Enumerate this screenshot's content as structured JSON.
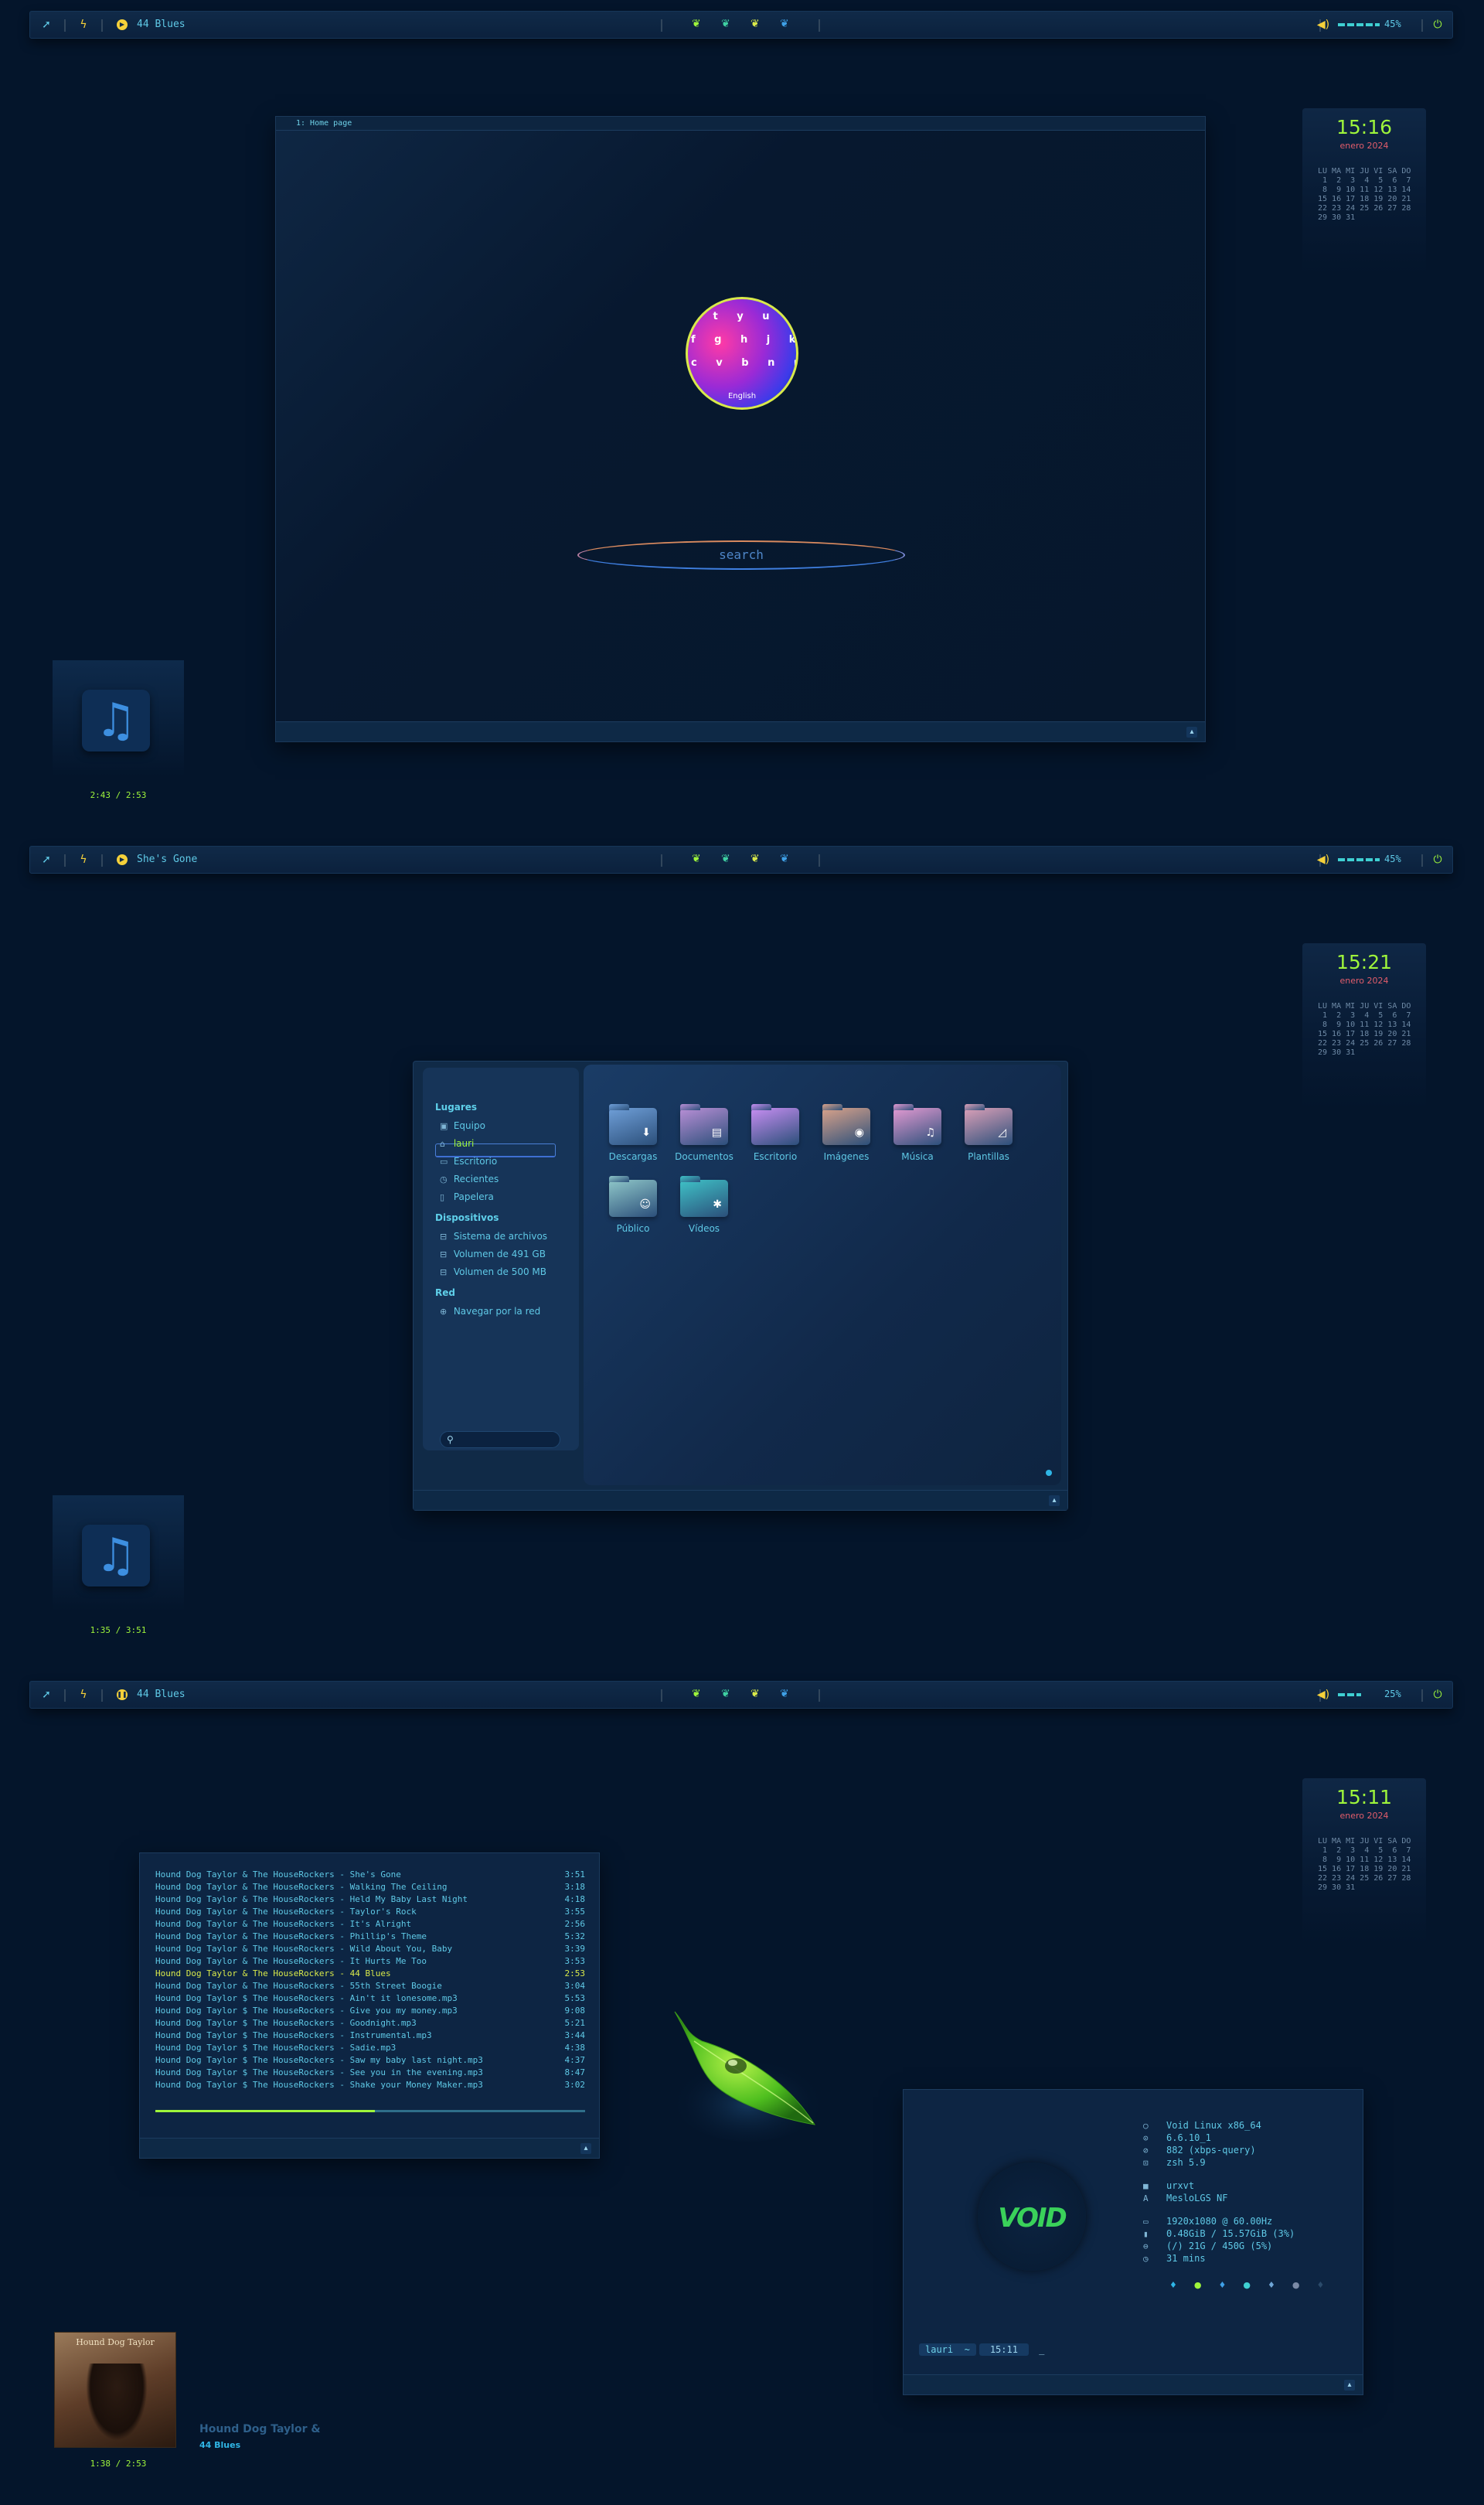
{
  "colors": {
    "bg": "#04152b",
    "accent": "#5fc9e6",
    "lime": "#9ef53b",
    "date_red": "#e25d6b",
    "yellow": "#d8e94a"
  },
  "bars": [
    {
      "track": "44 Blues",
      "volume": "45%",
      "volume_level": 0.45
    },
    {
      "track": "She's Gone",
      "volume": "45%",
      "volume_level": 0.45
    },
    {
      "track": "44 Blues",
      "volume": "25%",
      "volume_level": 0.25
    }
  ],
  "clocks": [
    {
      "time": "15:16",
      "date": "enero 2024"
    },
    {
      "time": "15:21",
      "date": "enero 2024"
    },
    {
      "time": "15:11",
      "date": "enero 2024"
    }
  ],
  "calendar": {
    "header": "LU MA MI JU VI SA DO",
    "weeks": [
      " 1  2  3  4  5  6  7",
      " 8  9 10 11 12 13 14",
      "15 16 17 18 19 20 21",
      "22 23 24 25 26 27 28",
      "29 30 31"
    ]
  },
  "music_times": [
    "2:43 / 2:53",
    "1:35 / 3:51",
    "1:38 / 2:53"
  ],
  "browser": {
    "tab": "1: Home page",
    "keyboard_keys": "t y u\nf g h j k\nc v b n m",
    "keyboard_lang": "English",
    "search_placeholder": "search"
  },
  "file_manager": {
    "sections": [
      {
        "title": "Lugares",
        "items": [
          {
            "icon": "computer-icon",
            "label": "Equipo"
          },
          {
            "icon": "home-icon",
            "label": "lauri"
          },
          {
            "icon": "desktop-icon",
            "label": "Escritorio"
          },
          {
            "icon": "clock-icon",
            "label": "Recientes"
          },
          {
            "icon": "trash-icon",
            "label": "Papelera"
          }
        ]
      },
      {
        "title": "Dispositivos",
        "items": [
          {
            "icon": "drive-icon",
            "label": "Sistema de archivos"
          },
          {
            "icon": "drive-icon",
            "label": "Volumen de 491 GB"
          },
          {
            "icon": "drive-icon",
            "label": "Volumen de 500 MB"
          }
        ]
      },
      {
        "title": "Red",
        "items": [
          {
            "icon": "network-icon",
            "label": "Navegar por la red"
          }
        ]
      }
    ],
    "folders": [
      {
        "label": "Descargas",
        "icon": "download-icon",
        "color": "#6f9fd8"
      },
      {
        "label": "Documentos",
        "icon": "document-icon",
        "color": "#b98fd6"
      },
      {
        "label": "Escritorio",
        "icon": "desktop-icon",
        "color": "#c78ef2"
      },
      {
        "label": "Imágenes",
        "icon": "camera-icon",
        "color": "#d9a28a"
      },
      {
        "label": "Música",
        "icon": "music-icon",
        "color": "#e39ad2"
      },
      {
        "label": "Plantillas",
        "icon": "template-icon",
        "color": "#dba0b8"
      },
      {
        "label": "Público",
        "icon": "users-icon",
        "color": "#8fc7c9"
      },
      {
        "label": "Vídeos",
        "icon": "video-icon",
        "color": "#3fc2c7"
      }
    ]
  },
  "playlist": {
    "current_index": 8,
    "progress": 0.51,
    "tracks": [
      {
        "title": "Hound Dog Taylor & The HouseRockers - She's Gone",
        "dur": "3:51"
      },
      {
        "title": "Hound Dog Taylor & The HouseRockers - Walking The Ceiling",
        "dur": "3:18"
      },
      {
        "title": "Hound Dog Taylor & The HouseRockers - Held My Baby Last Night",
        "dur": "4:18"
      },
      {
        "title": "Hound Dog Taylor & The HouseRockers - Taylor's Rock",
        "dur": "3:55"
      },
      {
        "title": "Hound Dog Taylor & The HouseRockers - It's Alright",
        "dur": "2:56"
      },
      {
        "title": "Hound Dog Taylor & The HouseRockers - Phillip's Theme",
        "dur": "5:32"
      },
      {
        "title": "Hound Dog Taylor & The HouseRockers - Wild About You, Baby",
        "dur": "3:39"
      },
      {
        "title": "Hound Dog Taylor & The HouseRockers - It Hurts Me Too",
        "dur": "3:53"
      },
      {
        "title": "Hound Dog Taylor & The HouseRockers - 44 Blues",
        "dur": "2:53"
      },
      {
        "title": "Hound Dog Taylor & The HouseRockers - 55th Street Boogie",
        "dur": "3:04"
      },
      {
        "title": "Hound Dog Taylor $ The HouseRockers - Ain't it lonesome.mp3",
        "dur": "5:53"
      },
      {
        "title": "Hound Dog Taylor $ The HouseRockers - Give you my money.mp3",
        "dur": "9:08"
      },
      {
        "title": "Hound Dog Taylor $ The HouseRockers - Goodnight.mp3",
        "dur": "5:21"
      },
      {
        "title": "Hound Dog Taylor $ The HouseRockers - Instrumental.mp3",
        "dur": "3:44"
      },
      {
        "title": "Hound Dog Taylor $ The HouseRockers - Sadie.mp3",
        "dur": "4:38"
      },
      {
        "title": "Hound Dog Taylor $ The HouseRockers - Saw my baby last night.mp3",
        "dur": "4:37"
      },
      {
        "title": "Hound Dog Taylor $ The HouseRockers - See you in the evening.mp3",
        "dur": "8:47"
      },
      {
        "title": "Hound Dog Taylor $ The HouseRockers - Shake your Money Maker.mp3",
        "dur": "3:02"
      }
    ]
  },
  "neofetch": {
    "logo": "VOID",
    "lines1": [
      {
        "glyph": "○",
        "text": "Void Linux x86_64"
      },
      {
        "glyph": "⊙",
        "text": "6.6.10_1"
      },
      {
        "glyph": "⊘",
        "text": "882 (xbps-query)"
      },
      {
        "glyph": "⊡",
        "text": "zsh 5.9"
      }
    ],
    "lines2": [
      {
        "glyph": "■",
        "text": "urxvt"
      },
      {
        "glyph": "A",
        "text": "MesloLGS NF"
      }
    ],
    "lines3": [
      {
        "glyph": "▭",
        "text": "1920x1080 @ 60.00Hz"
      },
      {
        "glyph": "▮",
        "text": "0.48GiB / 15.57GiB (3%)"
      },
      {
        "glyph": "⊖",
        "text": "(/)  21G / 450G (5%)"
      },
      {
        "glyph": "◷",
        "text": "31 mins"
      }
    ],
    "prompt_user": "lauri",
    "prompt_dir": "~",
    "prompt_time": "15:11",
    "cursor": "_"
  },
  "now_playing": {
    "artist": "Hound Dog Taylor &",
    "track": "44 Blues",
    "album_text": "Hound Dog Taylor"
  }
}
